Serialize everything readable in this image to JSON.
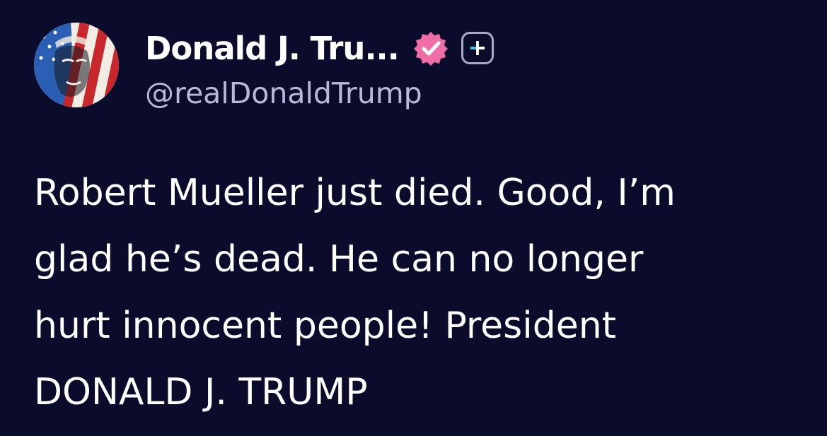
{
  "post": {
    "author": {
      "display_name": "Donald J. Tru...",
      "handle": "@realDonaldTrump",
      "avatar_icon": "avatar-flag-portrait",
      "verified_icon": "verified-badge-icon",
      "verified_color": "#f06ea6",
      "extra_badge_icon": "plus-icon"
    },
    "text_lines": [
      "Robert Mueller just died. Good, I’m",
      "glad he’s dead. He can no longer",
      "hurt innocent people! President",
      "DONALD J. TRUMP"
    ]
  },
  "colors": {
    "background": "#0b0b2c",
    "primary_text": "#ffffff",
    "secondary_text": "#b8bad6"
  }
}
